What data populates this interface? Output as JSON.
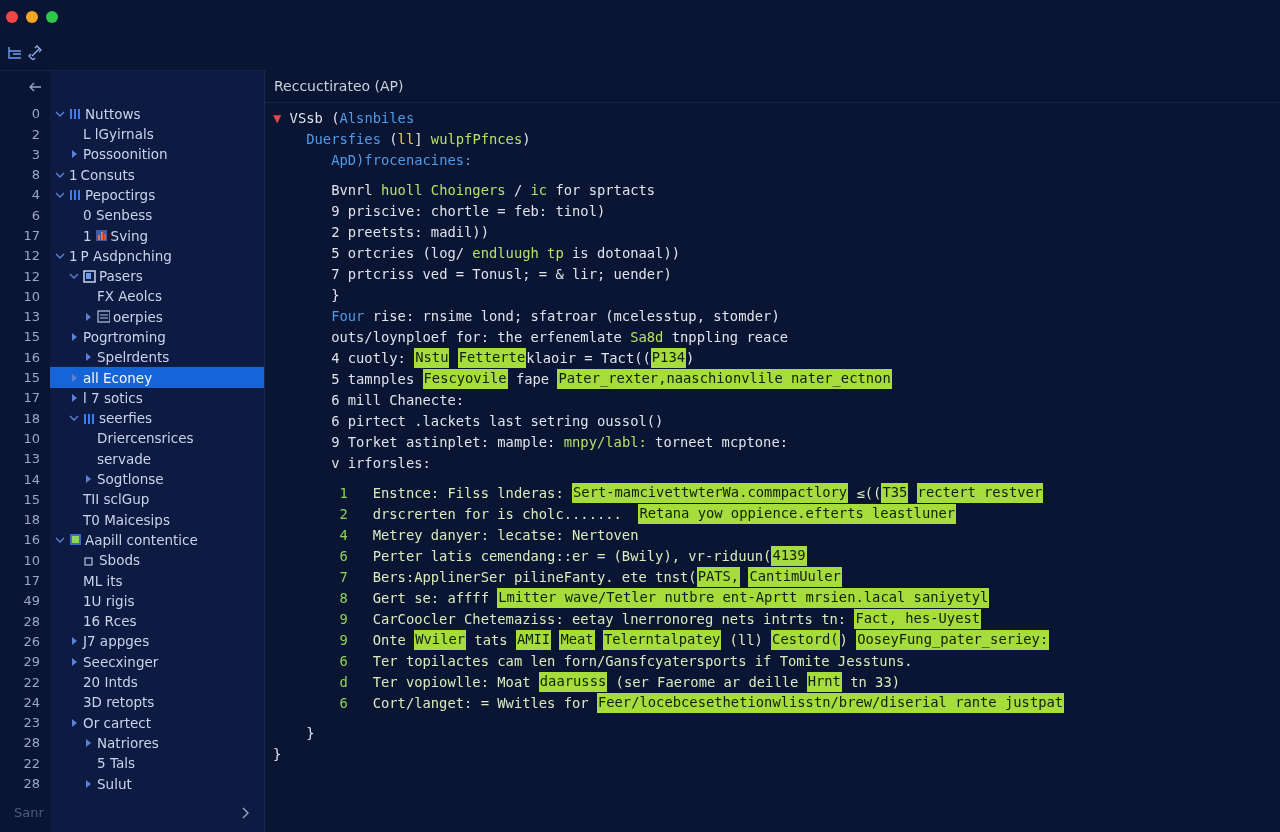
{
  "sidebar": {
    "items": [
      {
        "number": "0",
        "label": "Nuttows",
        "kind": "bars",
        "expanded": true,
        "selected": false,
        "children": [
          {
            "number": "2",
            "label": "L lGyirnals",
            "kind": "plain",
            "selected": false
          },
          {
            "number": "3",
            "label": "Possoonition",
            "kind": "plain",
            "expanded": false,
            "selected": false
          }
        ]
      },
      {
        "number": "8",
        "prefix": "1",
        "label": "Consuts",
        "kind": "plain",
        "expanded": true,
        "selected": false
      },
      {
        "number": "4",
        "label": "Pepoctirgs",
        "kind": "bars",
        "expanded": true,
        "selected": false,
        "children": [
          {
            "number": "6",
            "label": "0 Senbess",
            "kind": "plain",
            "selected": false
          },
          {
            "number": "17",
            "prefix": "1",
            "label": "Sving",
            "kind": "chart",
            "selected": false
          }
        ]
      },
      {
        "number": "12",
        "prefix": "1",
        "label": "P Asdpnching",
        "kind": "plain",
        "expanded": true,
        "selected": false,
        "children": [
          {
            "number": "12",
            "label": "Pasers",
            "kind": "card",
            "expanded": true,
            "selected": false,
            "children": [
              {
                "number": "10",
                "label": "FX Aeolcs",
                "kind": "plain",
                "selected": false
              },
              {
                "number": "13",
                "label": "oerpies",
                "kind": "panel",
                "expanded": false,
                "selected": false
              }
            ]
          },
          {
            "number": "15",
            "label": "Pogrtroming",
            "kind": "plain",
            "expanded": false,
            "selected": false,
            "children": [
              {
                "number": "16",
                "label": "Spelrdents",
                "kind": "plain",
                "expanded": false,
                "selected": false
              }
            ]
          },
          {
            "number": "15",
            "label": "all Econey",
            "kind": "plain",
            "expanded": false,
            "selected": true
          },
          {
            "number": "17",
            "label": "l 7 sotics",
            "kind": "plain",
            "expanded": false,
            "selected": false
          },
          {
            "number": "18",
            "label": "seerfies",
            "kind": "bars",
            "expanded": true,
            "selected": false,
            "children": [
              {
                "number": "10",
                "label": "Driercensrices",
                "kind": "plain",
                "selected": false
              },
              {
                "number": "13",
                "label": "servade",
                "kind": "plain",
                "selected": false
              },
              {
                "number": "14",
                "label": "Sogtlonse",
                "kind": "plain",
                "expanded": false,
                "selected": false
              }
            ]
          },
          {
            "number": "15",
            "label": "TII sclGup",
            "kind": "plain",
            "selected": false
          },
          {
            "number": "18",
            "label": "T0 Maicesips",
            "kind": "plain",
            "selected": false
          }
        ]
      },
      {
        "number": "16",
        "label": "Aapill contentice",
        "kind": "badge",
        "expanded": true,
        "selected": false,
        "children": [
          {
            "number": "10",
            "label": "Sbods",
            "kind": "square",
            "selected": false
          },
          {
            "number": "17",
            "label": "ML its",
            "kind": "plain",
            "selected": false
          },
          {
            "number": "49",
            "label": "1U rigis",
            "kind": "plain",
            "selected": false
          },
          {
            "number": "28",
            "label": "16 Rces",
            "kind": "plain",
            "selected": false
          },
          {
            "number": "26",
            "label": "J7 appges",
            "kind": "plain",
            "expanded": false,
            "selected": false
          },
          {
            "number": "29",
            "label": "Seecxinger",
            "kind": "plain",
            "expanded": false,
            "selected": false
          },
          {
            "number": "22",
            "label": "20 Intds",
            "kind": "plain",
            "selected": false
          },
          {
            "number": "24",
            "label": "3D retopts",
            "kind": "plain",
            "selected": false
          },
          {
            "number": "23",
            "label": "Or cartect",
            "kind": "plain",
            "expanded": false,
            "selected": false,
            "children": [
              {
                "number": "28",
                "label": "Natriores",
                "kind": "plain",
                "expanded": false,
                "selected": false
              },
              {
                "number": "22",
                "label": "5 Tals",
                "kind": "plain",
                "selected": false
              },
              {
                "number": "28",
                "label": "Sulut",
                "kind": "plain",
                "expanded": false,
                "selected": false
              }
            ]
          }
        ]
      }
    ],
    "footer": "Sanr"
  },
  "editor": {
    "title": "Reccuctirateo (AP)",
    "blocks": [
      {
        "lines": [
          {
            "tokens": [
              {
                "text": "▼",
                "kind": "caret"
              },
              {
                "text": " VSsb (",
                "kind": "plain"
              },
              {
                "text": "Alsnbiles",
                "kind": "blue"
              }
            ]
          },
          {
            "tokens": [
              {
                "text": "    Duersfies",
                "kind": "blue"
              },
              {
                "text": " (",
                "kind": "plain"
              },
              {
                "text": "ll",
                "kind": "mark"
              },
              {
                "text": "] ",
                "kind": "plain"
              },
              {
                "text": "wulpfPfnces",
                "kind": "green"
              },
              {
                "text": ")",
                "kind": "plain"
              }
            ]
          },
          {
            "tokens": [
              {
                "text": "       ApD)frocenacines:",
                "kind": "blue"
              }
            ]
          }
        ]
      },
      {
        "lines": [
          {
            "tokens": [
              {
                "text": "       Bvnrl ",
                "kind": "plain"
              },
              {
                "text": "huoll Choingers",
                "kind": "green"
              },
              {
                "text": " / ",
                "kind": "plain"
              },
              {
                "text": "ic",
                "kind": "green"
              },
              {
                "text": " for sprtacts",
                "kind": "plain"
              }
            ]
          },
          {
            "tokens": [
              {
                "text": "       9 priscive: chortle = feb: tinol)",
                "kind": "plain"
              }
            ]
          },
          {
            "tokens": [
              {
                "text": "       2 preetsts: madil))",
                "kind": "plain"
              }
            ]
          },
          {
            "tokens": [
              {
                "text": "       5 ortcries (log/ ",
                "kind": "plain"
              },
              {
                "text": "endluugh tp",
                "kind": "green"
              },
              {
                "text": " is dotonaal))",
                "kind": "plain"
              }
            ]
          },
          {
            "tokens": [
              {
                "text": "       7 prtcriss ved = Tonusl; = & lir; uender)",
                "kind": "plain"
              }
            ]
          },
          {
            "tokens": [
              {
                "text": "       }",
                "kind": "plain"
              }
            ]
          },
          {
            "tokens": [
              {
                "text": "       Four",
                "kind": "blue"
              },
              {
                "text": " rise: rnsime lond; sfatroar (mcelesstup, stomder)",
                "kind": "plain"
              }
            ]
          },
          {
            "tokens": [
              {
                "text": "       outs/loynploef for: the erfenemlate ",
                "kind": "plain"
              },
              {
                "text": "Sa8d",
                "kind": "green"
              },
              {
                "text": " tnppling reace",
                "kind": "plain"
              }
            ]
          },
          {
            "tokens": [
              {
                "text": "       4 cuotly: ",
                "kind": "plain"
              },
              {
                "text": "Nstu",
                "kind": "highlight"
              },
              {
                "text": "Fetterte",
                "kind": "highlight"
              },
              {
                "text": "klaoir = Tact((",
                "kind": "plain"
              },
              {
                "text": "P134",
                "kind": "highlight"
              },
              {
                "text": ")",
                "kind": "plain"
              }
            ]
          },
          {
            "tokens": [
              {
                "text": "       5 tamnples ",
                "kind": "plain"
              },
              {
                "text": "Fescyovile",
                "kind": "highlight"
              },
              {
                "text": " fape ",
                "kind": "plain"
              },
              {
                "text": "Pater_rexter,naaschionvlile nater_ectnon",
                "kind": "highlight"
              }
            ]
          },
          {
            "tokens": [
              {
                "text": "       6 mill Chanecte:",
                "kind": "plain"
              }
            ]
          },
          {
            "tokens": [
              {
                "text": "       6 pirtect .lackets last setring oussol()",
                "kind": "plain"
              }
            ]
          },
          {
            "tokens": [
              {
                "text": "       9 Torket astinplet: mample: ",
                "kind": "plain"
              },
              {
                "text": "mnpy/labl:",
                "kind": "green"
              },
              {
                "text": " torneet mcptone:",
                "kind": "plain"
              }
            ]
          },
          {
            "tokens": [
              {
                "text": "       v irforsles:",
                "kind": "plain"
              }
            ]
          }
        ]
      },
      {
        "lines": [
          {
            "number": "1",
            "tokens": [
              {
                "text": "Enstnce: Filss lnderas: ",
                "kind": "pale"
              },
              {
                "text": "Sert-mamcivettwterWa.commpactlory",
                "kind": "highlight"
              },
              {
                "text": " ≤((",
                "kind": "pale"
              },
              {
                "text": "T35",
                "kind": "highlight"
              },
              {
                "text": "rectert restver",
                "kind": "highlight"
              }
            ]
          },
          {
            "number": "2",
            "tokens": [
              {
                "text": "drscrerten for is cholc.......  ",
                "kind": "pale"
              },
              {
                "text": "Retana yow oppience.efterts leastluner",
                "kind": "highlight"
              }
            ]
          },
          {
            "number": "4",
            "tokens": [
              {
                "text": "Metrey danyer: lecatse: Nertoven",
                "kind": "pale"
              }
            ]
          },
          {
            "number": "6",
            "tokens": [
              {
                "text": "Perter latis cemendang::er = (Bwily), vr-riduun(",
                "kind": "pale"
              },
              {
                "text": "4139",
                "kind": "highlight"
              }
            ]
          },
          {
            "number": "7",
            "tokens": [
              {
                "text": "Bers:ApplinerSer pilineFanty. ete tnst(",
                "kind": "pale"
              },
              {
                "text": "PATS,",
                "kind": "highlight"
              },
              {
                "text": "CantimUuler",
                "kind": "highlight"
              }
            ]
          },
          {
            "number": "8",
            "tokens": [
              {
                "text": "Gert se: affff ",
                "kind": "pale"
              },
              {
                "text": "Lmitter wave/Tetler nutbre ent-Aprtt mrsien.lacal saniyetyl",
                "kind": "highlight"
              }
            ]
          },
          {
            "number": "9",
            "tokens": [
              {
                "text": "CarCoocler Chetemaziss: eetay lnerronoreg nets intrts tn: ",
                "kind": "pale"
              },
              {
                "text": "Fact, hes-Uyest",
                "kind": "highlight"
              }
            ]
          },
          {
            "number": "9",
            "tokens": [
              {
                "text": "Onte ",
                "kind": "pale"
              },
              {
                "text": "Wviler",
                "kind": "highlight"
              },
              {
                "text": " tats ",
                "kind": "pale"
              },
              {
                "text": "AMII",
                "kind": "highlight"
              },
              {
                "text": "Meat",
                "kind": "highlight"
              },
              {
                "text": "Telerntalpatey",
                "kind": "highlight"
              },
              {
                "text": " (ll) ",
                "kind": "pale"
              },
              {
                "text": "Cestord(",
                "kind": "highlight"
              },
              {
                "text": ") ",
                "kind": "pale"
              },
              {
                "text": "OoseyFung_pater_seriey:",
                "kind": "highlight"
              }
            ]
          },
          {
            "number": "6",
            "tokens": [
              {
                "text": "Ter topilactes cam len forn/Gansfcyatersports if Tomite Jesstuns.",
                "kind": "pale"
              }
            ]
          },
          {
            "number": "d",
            "tokens": [
              {
                "text": "Ter vopiowlle: Moat ",
                "kind": "pale"
              },
              {
                "text": "daarusss",
                "kind": "highlight"
              },
              {
                "text": " (ser Faerome ar deille ",
                "kind": "pale"
              },
              {
                "text": "Hrnt",
                "kind": "highlight"
              },
              {
                "text": " tn 33)",
                "kind": "pale"
              }
            ]
          },
          {
            "number": "6",
            "tokens": [
              {
                "text": "Cort/langet: = Wwitles for ",
                "kind": "pale"
              },
              {
                "text": "Feer/locebcesethetionwlisstn/brew/diserial rante justpat",
                "kind": "highlight"
              }
            ]
          }
        ]
      },
      {
        "lines": [
          {
            "tokens": [
              {
                "text": "    }",
                "kind": "plain"
              }
            ]
          },
          {
            "tokens": [
              {
                "text": "}",
                "kind": "plain"
              }
            ]
          }
        ]
      }
    ]
  }
}
